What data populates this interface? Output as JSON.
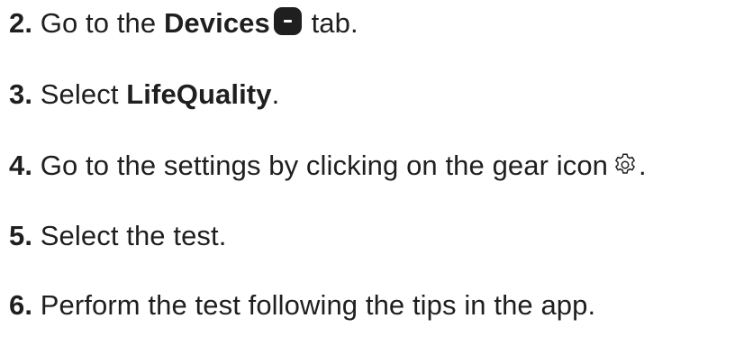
{
  "steps": [
    {
      "number": "2.",
      "text_before": "Go to the",
      "bold": "Devices",
      "icon": "devices-icon",
      "text_after": "tab."
    },
    {
      "number": "3.",
      "text_before": "Select",
      "bold": "LifeQuality",
      "text_after": "."
    },
    {
      "number": "4.",
      "text_before": "Go to the settings by clicking on the gear icon",
      "icon": "gear-icon",
      "text_after": "."
    },
    {
      "number": "5.",
      "text": "Select the test."
    },
    {
      "number": "6.",
      "text": "Perform the test following the tips in the app."
    }
  ],
  "colors": {
    "text": "#1f1f1f",
    "background": "#ffffff"
  }
}
